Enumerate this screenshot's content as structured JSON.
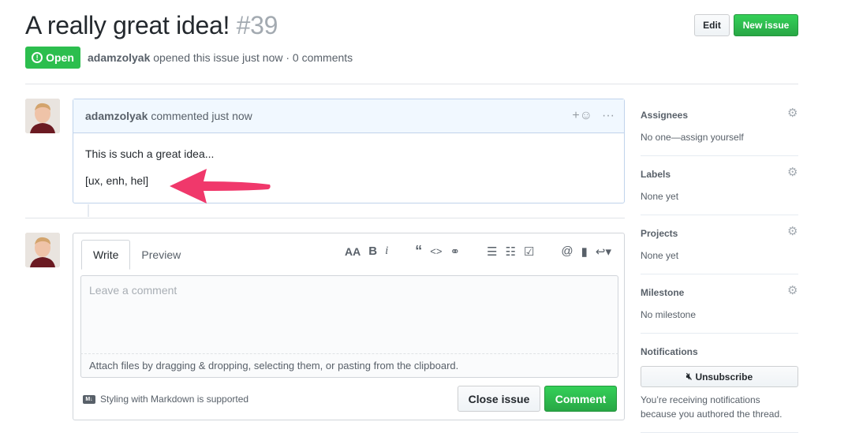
{
  "issue": {
    "title": "A really great idea!",
    "number": "#39",
    "state": "Open",
    "author": "adamzolyak",
    "opened_text": "opened this issue just now · 0 comments"
  },
  "header_buttons": {
    "edit": "Edit",
    "new_issue": "New issue"
  },
  "comment": {
    "author": "adamzolyak",
    "time_text": "commented just now",
    "reaction_icon": "smiley-add-icon",
    "more_icon": "ellipsis-icon",
    "body_line1": "This is such a great idea...",
    "body_line2": "[ux, enh, hel]"
  },
  "editor": {
    "tabs": [
      "Write",
      "Preview"
    ],
    "toolbar_icons": [
      "heading-icon",
      "bold-icon",
      "italic-icon",
      "quote-icon",
      "code-icon",
      "link-icon",
      "bullet-list-icon",
      "numbered-list-icon",
      "task-list-icon",
      "mention-icon",
      "reference-icon",
      "reply-icon"
    ],
    "placeholder": "Leave a comment",
    "attach_text": "Attach files by dragging & dropping, selecting them, or pasting from the clipboard.",
    "markdown_note": "Styling with Markdown is supported",
    "close_button": "Close issue",
    "comment_button": "Comment"
  },
  "sidebar": {
    "assignees": {
      "title": "Assignees",
      "value": "No one—assign yourself"
    },
    "labels": {
      "title": "Labels",
      "value": "None yet"
    },
    "projects": {
      "title": "Projects",
      "value": "None yet"
    },
    "milestone": {
      "title": "Milestone",
      "value": "No milestone"
    },
    "notifications": {
      "title": "Notifications",
      "button": "Unsubscribe",
      "note": "You’re receiving notifications because you authored the thread."
    }
  },
  "colors": {
    "open_green": "#2cbe4e",
    "annotation_arrow": "#f0386b",
    "comment_header_bg": "#f1f8ff"
  }
}
